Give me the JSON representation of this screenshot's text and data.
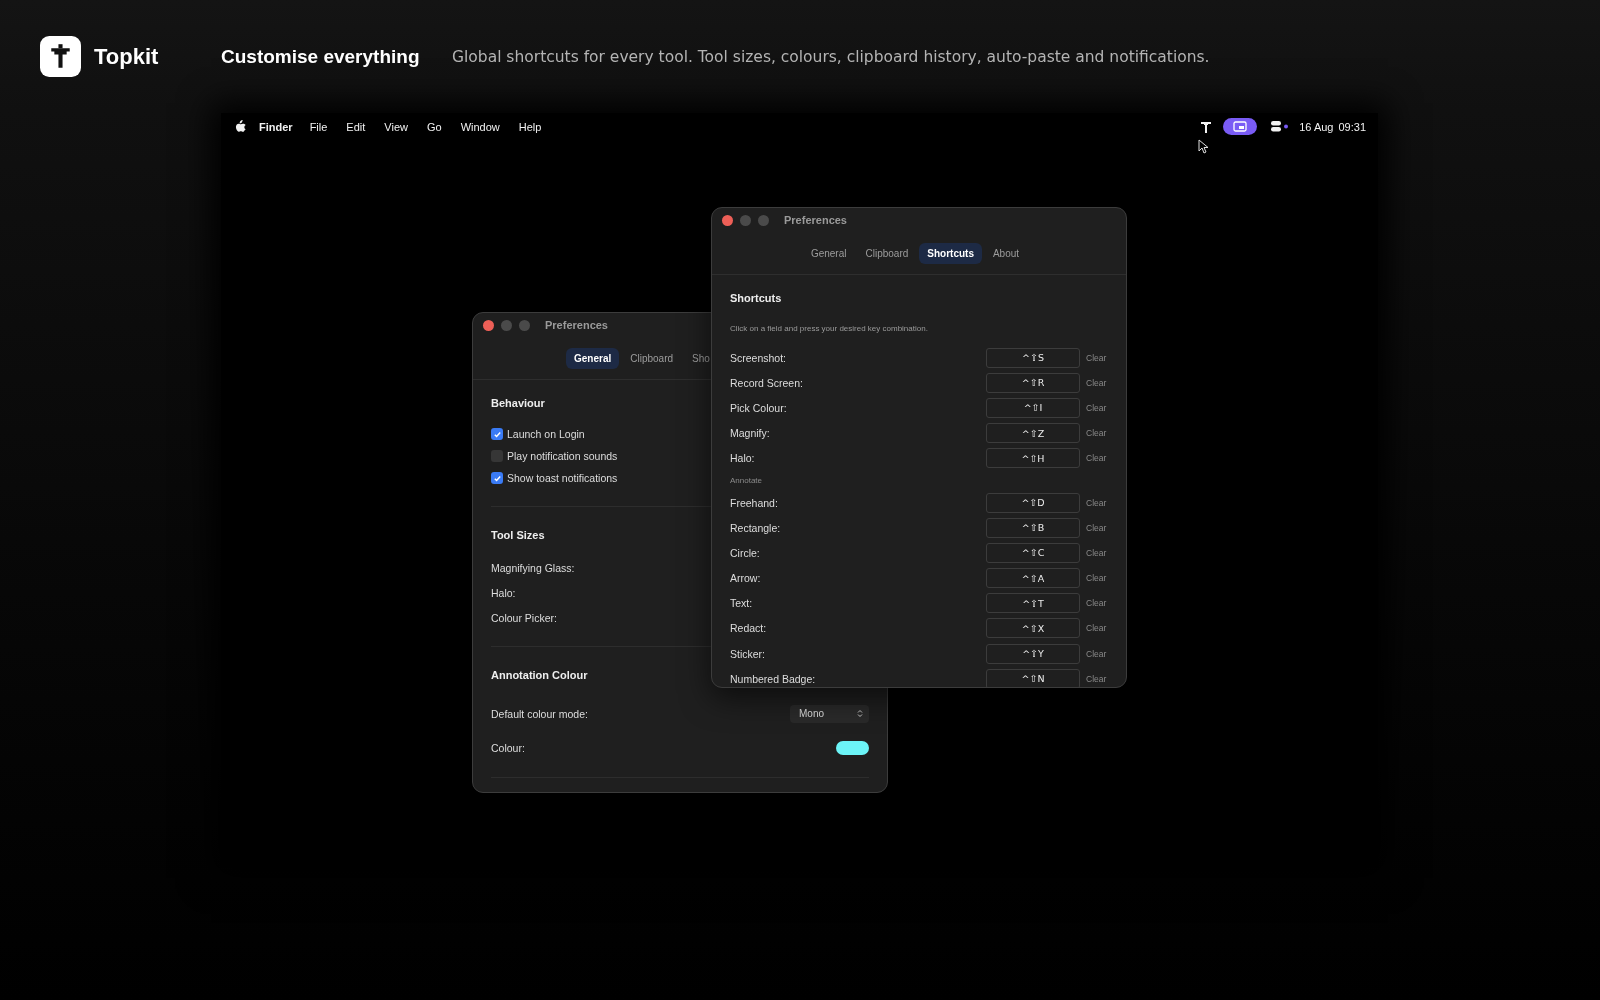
{
  "header": {
    "app_name": "Topkit",
    "headline": "Customise everything",
    "description": "Global shortcuts for every tool. Tool sizes, colours, clipboard history, auto-paste and notifications."
  },
  "menu_bar": {
    "items": [
      {
        "label": "Finder",
        "kind": "app"
      },
      {
        "label": "File",
        "kind": "menu"
      },
      {
        "label": "Edit",
        "kind": "menu"
      },
      {
        "label": "View",
        "kind": "menu"
      },
      {
        "label": "Go",
        "kind": "menu"
      },
      {
        "label": "Window",
        "kind": "menu"
      },
      {
        "label": "Help",
        "kind": "menu"
      }
    ],
    "date": "16 Aug",
    "time": "09:31"
  },
  "back_window": {
    "title": "Preferences",
    "tabs": [
      {
        "label": "General",
        "selected": true
      },
      {
        "label": "Clipboard",
        "selected": false
      },
      {
        "label": "Sho",
        "selected": false
      }
    ],
    "behaviour": {
      "heading": "Behaviour",
      "options": [
        {
          "label": "Launch on Login",
          "checked": true
        },
        {
          "label": "Play notification sounds",
          "checked": false
        },
        {
          "label": "Show toast notifications",
          "checked": true
        }
      ]
    },
    "tool_sizes": {
      "heading": "Tool Sizes",
      "labels": [
        "Magnifying Glass:",
        "Halo:",
        "Colour Picker:"
      ]
    },
    "annotation_colour": {
      "heading": "Annotation Colour",
      "mode_label": "Default colour mode:",
      "mode_value": "Mono",
      "colour_label": "Colour:"
    }
  },
  "front_window": {
    "title": "Preferences",
    "tabs": [
      {
        "label": "General",
        "selected": false
      },
      {
        "label": "Clipboard",
        "selected": false
      },
      {
        "label": "Shortcuts",
        "selected": true
      },
      {
        "label": "About",
        "selected": false
      }
    ],
    "heading": "Shortcuts",
    "hint": "Click on a field and press your desired key combination.",
    "rows": [
      {
        "kind": "shortcut",
        "label": "Screenshot:",
        "keys": "^⇧S",
        "action": "Clear"
      },
      {
        "kind": "shortcut",
        "label": "Record Screen:",
        "keys": "^⇧R",
        "action": "Clear"
      },
      {
        "kind": "shortcut",
        "label": "Pick Colour:",
        "keys": "^⇧I",
        "action": "Clear"
      },
      {
        "kind": "shortcut",
        "label": "Magnify:",
        "keys": "^⇧Z",
        "action": "Clear"
      },
      {
        "kind": "shortcut",
        "label": "Halo:",
        "keys": "^⇧H",
        "action": "Clear"
      },
      {
        "kind": "subheading",
        "label": "Annotate"
      },
      {
        "kind": "shortcut",
        "label": "Freehand:",
        "keys": "^⇧D",
        "action": "Clear"
      },
      {
        "kind": "shortcut",
        "label": "Rectangle:",
        "keys": "^⇧B",
        "action": "Clear"
      },
      {
        "kind": "shortcut",
        "label": "Circle:",
        "keys": "^⇧C",
        "action": "Clear"
      },
      {
        "kind": "shortcut",
        "label": "Arrow:",
        "keys": "^⇧A",
        "action": "Clear"
      },
      {
        "kind": "shortcut",
        "label": "Text:",
        "keys": "^⇧T",
        "action": "Clear"
      },
      {
        "kind": "shortcut",
        "label": "Redact:",
        "keys": "^⇧X",
        "action": "Clear"
      },
      {
        "kind": "shortcut",
        "label": "Sticker:",
        "keys": "^⇧Y",
        "action": "Clear"
      },
      {
        "kind": "shortcut",
        "label": "Numbered Badge:",
        "keys": "^⇧N",
        "action": "Clear"
      }
    ]
  }
}
